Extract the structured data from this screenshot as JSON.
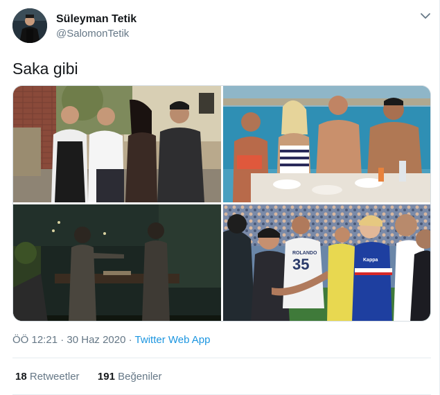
{
  "tweet": {
    "author_name": "Süleyman Tetik",
    "author_handle": "@SalomonTetik",
    "text": "Saka gibi",
    "time": "ÖÖ 12:21",
    "separator1": " · ",
    "date": "30 Haz 2020",
    "separator2": " · ",
    "source": "Twitter Web App",
    "retweets_count": "18",
    "retweets_label": "Retweetler",
    "likes_count": "191",
    "likes_label": "Beğeniler"
  },
  "photos": {
    "p4_jersey_text": "ROLANDO",
    "p4_jersey_number": "35",
    "p4_kit_brand": "Kappa"
  },
  "colors": {
    "link": "#1b95e0",
    "secondary_text": "#657786",
    "primary_text": "#14171a",
    "divider": "#e6ecf0"
  },
  "icons": {
    "menu": "chevron-down-icon"
  }
}
